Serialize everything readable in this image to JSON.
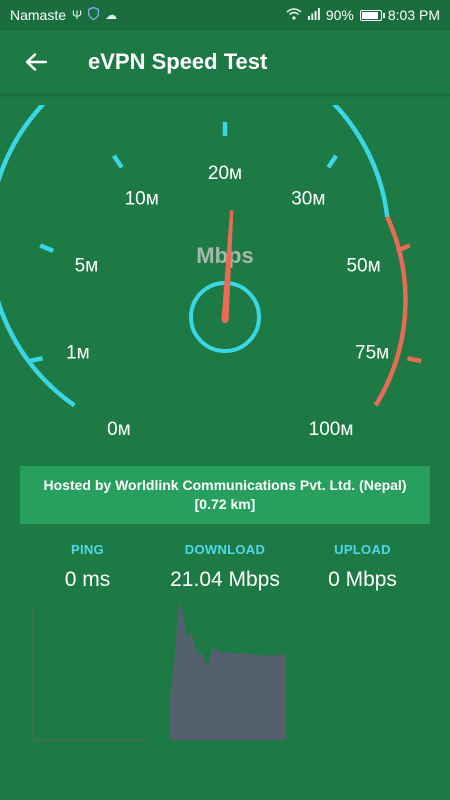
{
  "status_bar": {
    "carrier": "Namaste",
    "battery": "90%",
    "time": "8:03 PM"
  },
  "app_bar": {
    "title": "eVPN Speed Test"
  },
  "gauge": {
    "unit": "Mbps",
    "tick_labels": [
      "0м",
      "1м",
      "5м",
      "10м",
      "20м",
      "30м",
      "50м",
      "75м",
      "100м"
    ],
    "needle_value_mbps": 21.04,
    "colors": {
      "normal": "#39d6e6",
      "high": "#e96a55",
      "needle": "#e96a55"
    }
  },
  "server": {
    "host_line": "Hosted by Worldlink Communications Pvt. Ltd. (Nepal)",
    "distance": "[0.72 km]"
  },
  "metrics": {
    "ping_label": "PING",
    "ping_value": "0 ms",
    "download_label": "DOWNLOAD",
    "download_value": "21.04 Mbps",
    "upload_label": "UPLOAD",
    "upload_value": "0 Mbps"
  },
  "colors": {
    "background": "#1e7a45",
    "accent": "#4fd8ea",
    "graph_fill": "#55606e"
  }
}
